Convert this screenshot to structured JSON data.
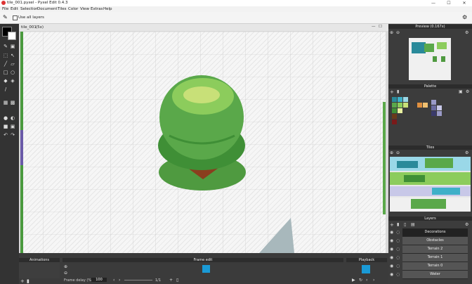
{
  "window": {
    "title": "tile_001.pyxel - Pyxel Edit 0.4.3",
    "minimize": "—",
    "maximize": "☐",
    "close": "✕"
  },
  "menu": [
    "File",
    "Edit",
    "Selection",
    "Document",
    "Tiles",
    "Color",
    "View",
    "Extras",
    "Help"
  ],
  "toolbar": {
    "use_all_layers": "Use all layers"
  },
  "canvas": {
    "tab_label": "tile_001",
    "zoom": "(5x)"
  },
  "preview": {
    "title": "Preview (0.167x)"
  },
  "palette": {
    "title": "Palette",
    "colors": [
      "#2a8a9a",
      "#3fb0c8",
      "#9ad8e8",
      "#c8e8f0",
      "#5aa34a",
      "#8fce5e",
      "#b8e07a",
      "#e9f0a0",
      "#6a3a1a",
      "#a85a2a",
      "#e09040",
      "#f0c070",
      "#3a3a6a",
      "#6a6aa0",
      "#9a9ac8",
      "#c8c8e8",
      "#7a1a1a",
      "#b03030"
    ]
  },
  "tiles": {
    "title": "Tiles"
  },
  "layers": {
    "title": "Layers",
    "items": [
      {
        "name": "Decorations",
        "selected": true
      },
      {
        "name": "Obstacles",
        "selected": false
      },
      {
        "name": "Terrain 2",
        "selected": false
      },
      {
        "name": "Terrain 1",
        "selected": false
      },
      {
        "name": "Terrain 0",
        "selected": false
      },
      {
        "name": "Water",
        "selected": false
      }
    ]
  },
  "animations": {
    "title": "Animations"
  },
  "frame_edit": {
    "title": "Frame edit",
    "frame_delay_label": "Frame delay (%)",
    "frame_delay_value": "100",
    "frame_counter": "1/1"
  },
  "playback": {
    "title": "Playback"
  },
  "colors": {
    "primary": "#000000",
    "secondary": "#ffffff",
    "accent": "#1a9ad6",
    "tree_dark": "#3f8f36",
    "tree_mid": "#5aa84a",
    "tree_light": "#8ccc5c",
    "highlight": "#c8e078",
    "trunk": "#8a3e1e"
  }
}
